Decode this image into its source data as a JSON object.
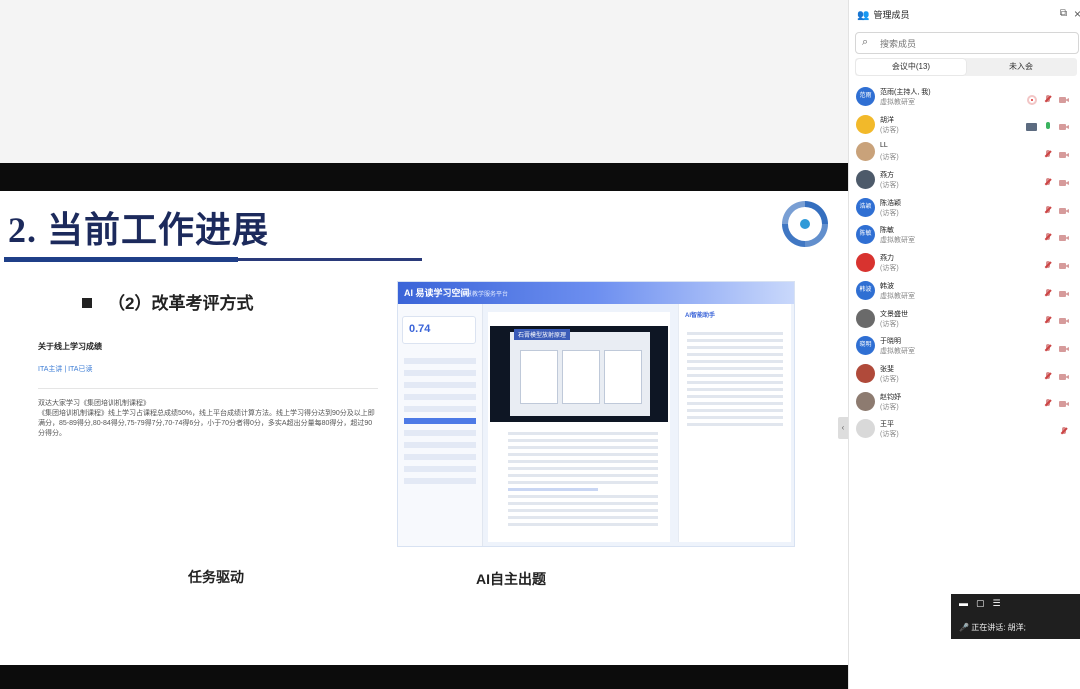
{
  "slide": {
    "title": "2. 当前工作进展",
    "subheading": "（2）改革考评方式",
    "doc_title": "关于线上学习成绩",
    "doc_link": "ITA主讲 | ITA已读",
    "doc_body_1": "双达大家学习《集团培训机制课程》",
    "doc_body_2": "《集团培训机制课程》线上学习占课程总成绩50%，线上平台成绩计算方法。线上学习得分达到90分及以上即满分，85-89得分,80-84得分,75-79得7分,70-74得6分，小于70分者得0分，多实A超出分量每80得分，超过90分得分。",
    "caption_left": "任务驱动",
    "caption_right": "AI自主出题",
    "ai_logo": "AI 易读学习空间",
    "ai_sub": "智慧教学服务平台",
    "ai_score": "0.74",
    "ai_video_label": "石膏模型放射原理",
    "ai_right_title": "AI智能助手"
  },
  "panel": {
    "title": "管理成员",
    "search_placeholder": "搜索成员",
    "tab_in": "会议中(13)",
    "tab_out": "未入会"
  },
  "members": [
    {
      "name": "范雨(主持人, 我)",
      "role": "虚拟教研室",
      "avatar_text": "范雨",
      "avatar_color": "#2f6fd3",
      "icons": [
        "rec",
        "mic",
        "cam"
      ]
    },
    {
      "name": "胡洋",
      "role": "(访客)",
      "avatar_text": "",
      "avatar_color": "#f2b92a",
      "icons": [
        "share",
        "mic-on",
        "cam"
      ]
    },
    {
      "name": "LL",
      "role": "(访客)",
      "avatar_text": "",
      "avatar_color": "#c9a27a",
      "icons": [
        "mic",
        "cam"
      ]
    },
    {
      "name": "燕方",
      "role": "(访客)",
      "avatar_text": "",
      "avatar_color": "#4d5a6a",
      "icons": [
        "mic",
        "cam"
      ]
    },
    {
      "name": "陈浩颖",
      "role": "(访客)",
      "avatar_text": "浩颖",
      "avatar_color": "#2f6fd3",
      "icons": [
        "mic",
        "cam"
      ]
    },
    {
      "name": "陈敏",
      "role": "虚拟教研室",
      "avatar_text": "陈敏",
      "avatar_color": "#2f6fd3",
      "icons": [
        "mic",
        "cam"
      ]
    },
    {
      "name": "燕力",
      "role": "(访客)",
      "avatar_text": "",
      "avatar_color": "#d8332f",
      "icons": [
        "mic",
        "cam"
      ]
    },
    {
      "name": "韩波",
      "role": "虚拟教研室",
      "avatar_text": "韩波",
      "avatar_color": "#2f6fd3",
      "icons": [
        "mic",
        "cam"
      ]
    },
    {
      "name": "文景盛世",
      "role": "(访客)",
      "avatar_text": "",
      "avatar_color": "#6a6a6a",
      "icons": [
        "mic",
        "cam"
      ]
    },
    {
      "name": "于晓明",
      "role": "虚拟教研室",
      "avatar_text": "晓明",
      "avatar_color": "#2f6fd3",
      "icons": [
        "mic",
        "cam"
      ]
    },
    {
      "name": "张斐",
      "role": "(访客)",
      "avatar_text": "",
      "avatar_color": "#b04a3a",
      "icons": [
        "mic",
        "cam"
      ]
    },
    {
      "name": "赵钧妤",
      "role": "(访客)",
      "avatar_text": "",
      "avatar_color": "#8d7b70",
      "icons": [
        "mic",
        "cam"
      ]
    },
    {
      "name": "王平",
      "role": "(访客)",
      "avatar_text": "",
      "avatar_color": "#d9d9d9",
      "icons": [
        "mic"
      ]
    }
  ],
  "speaking": {
    "label": "正在讲话:",
    "name": "胡洋;"
  }
}
